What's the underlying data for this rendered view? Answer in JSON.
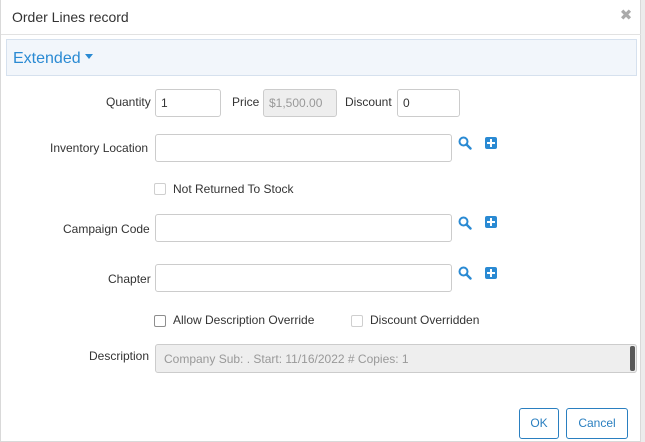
{
  "dialog": {
    "title": "Order Lines record",
    "close_glyph": "✖"
  },
  "section": {
    "label": "Extended"
  },
  "form": {
    "quantity": {
      "label": "Quantity",
      "value": "1"
    },
    "price": {
      "label": "Price",
      "value": "$1,500.00"
    },
    "discount": {
      "label": "Discount",
      "value": "0"
    },
    "inventory_location": {
      "label": "Inventory Location",
      "value": ""
    },
    "not_returned_to_stock": {
      "label": "Not Returned To Stock",
      "checked": false
    },
    "campaign_code": {
      "label": "Campaign Code",
      "value": ""
    },
    "chapter": {
      "label": "Chapter",
      "value": ""
    },
    "allow_description_override": {
      "label": "Allow Description Override",
      "checked": false
    },
    "discount_overridden": {
      "label": "Discount Overridden",
      "checked": false
    },
    "description": {
      "label": "Description",
      "value": "Company Sub: . Start: 11/16/2022 # Copies: 1"
    }
  },
  "buttons": {
    "ok": "OK",
    "cancel": "Cancel"
  },
  "colors": {
    "accent": "#2a8ad3",
    "section_bg": "#f2f6fb"
  },
  "icons": {
    "search": "search-icon",
    "add": "plus-icon",
    "close": "close-icon",
    "caret": "caret-down-icon"
  }
}
